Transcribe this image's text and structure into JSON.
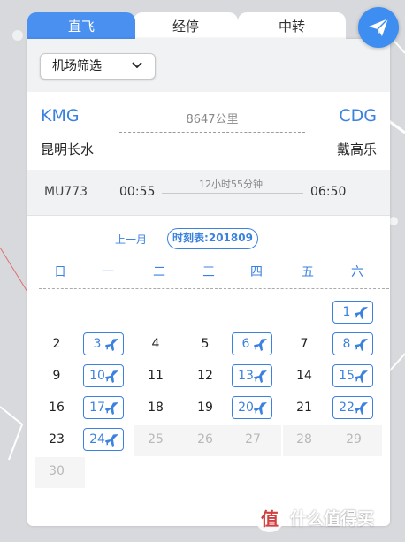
{
  "tabs": [
    {
      "label": "直飞",
      "active": true
    },
    {
      "label": "经停",
      "active": false
    },
    {
      "label": "中转",
      "active": false
    }
  ],
  "send_icon": "paper-plane-icon",
  "filter": {
    "label": "机场筛选",
    "icon": "chevron-down-icon"
  },
  "route": {
    "from_code": "KMG",
    "to_code": "CDG",
    "distance": "8647公里",
    "from_city": "昆明长水",
    "to_city": "戴高乐"
  },
  "flight": {
    "number": "MU773",
    "depart": "00:55",
    "duration": "12小时55分钟",
    "arrive": "06:50"
  },
  "calendar": {
    "prev_month": "上一月",
    "schedule_label": "时刻表:201809",
    "weekdays": [
      "日",
      "一",
      "二",
      "三",
      "四",
      "五",
      "六"
    ],
    "days": [
      {
        "d": "1",
        "col": 6,
        "row": 0,
        "flight": true
      },
      {
        "d": "2",
        "col": 0,
        "row": 1
      },
      {
        "d": "3",
        "col": 1,
        "row": 1,
        "flight": true
      },
      {
        "d": "4",
        "col": 2,
        "row": 1
      },
      {
        "d": "5",
        "col": 3,
        "row": 1
      },
      {
        "d": "6",
        "col": 4,
        "row": 1,
        "flight": true
      },
      {
        "d": "7",
        "col": 5,
        "row": 1
      },
      {
        "d": "8",
        "col": 6,
        "row": 1,
        "flight": true
      },
      {
        "d": "9",
        "col": 0,
        "row": 2
      },
      {
        "d": "10",
        "col": 1,
        "row": 2,
        "flight": true
      },
      {
        "d": "11",
        "col": 2,
        "row": 2
      },
      {
        "d": "12",
        "col": 3,
        "row": 2
      },
      {
        "d": "13",
        "col": 4,
        "row": 2,
        "flight": true
      },
      {
        "d": "14",
        "col": 5,
        "row": 2
      },
      {
        "d": "15",
        "col": 6,
        "row": 2,
        "flight": true
      },
      {
        "d": "16",
        "col": 0,
        "row": 3
      },
      {
        "d": "17",
        "col": 1,
        "row": 3,
        "flight": true
      },
      {
        "d": "18",
        "col": 2,
        "row": 3
      },
      {
        "d": "19",
        "col": 3,
        "row": 3
      },
      {
        "d": "20",
        "col": 4,
        "row": 3,
        "flight": true
      },
      {
        "d": "21",
        "col": 5,
        "row": 3
      },
      {
        "d": "22",
        "col": 6,
        "row": 3,
        "flight": true
      },
      {
        "d": "23",
        "col": 0,
        "row": 4
      },
      {
        "d": "24",
        "col": 1,
        "row": 4,
        "flight": true
      },
      {
        "d": "25",
        "col": 2,
        "row": 4,
        "faded": true
      },
      {
        "d": "26",
        "col": 3,
        "row": 4,
        "faded": true
      },
      {
        "d": "27",
        "col": 4,
        "row": 4,
        "faded": true
      },
      {
        "d": "28",
        "col": 5,
        "row": 4,
        "faded": true
      },
      {
        "d": "29",
        "col": 6,
        "row": 4,
        "faded": true
      },
      {
        "d": "30",
        "col": 0,
        "row": 5,
        "faded": true
      }
    ]
  },
  "watermark": {
    "logo": "值",
    "text": "什么值得买"
  },
  "colors": {
    "accent": "#3b82e0",
    "tab_active": "#4a90f0"
  }
}
